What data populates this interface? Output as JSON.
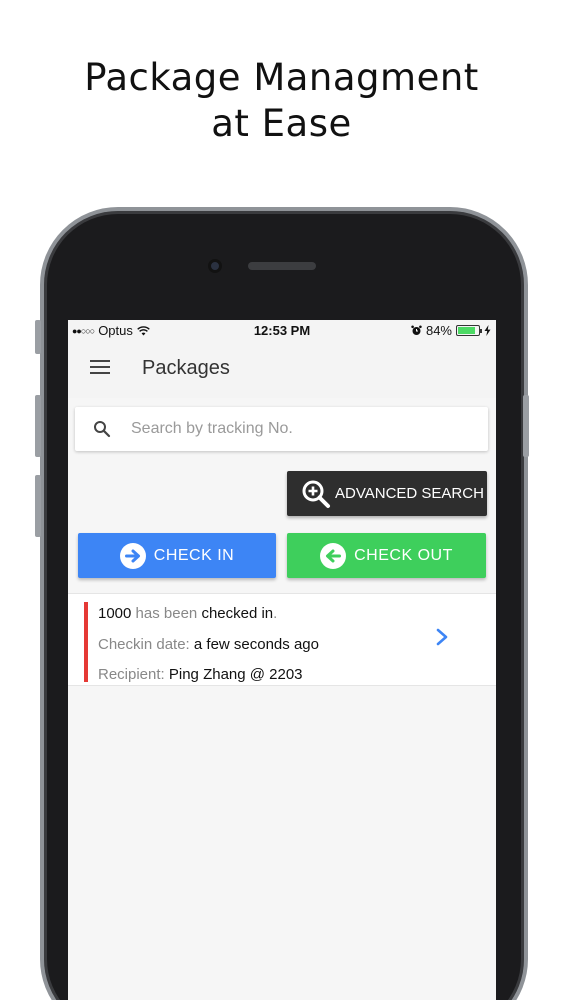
{
  "headline": {
    "line1": "Package Managment",
    "line2": "at Ease"
  },
  "status_bar": {
    "carrier": "Optus",
    "signal_dots": "●●○○○",
    "time": "12:53 PM",
    "battery": "84%",
    "battery_level": 0.84,
    "icons": [
      "wifi-icon",
      "alarm-icon",
      "battery-icon",
      "charging-icon"
    ]
  },
  "app_bar": {
    "title": "Packages",
    "menu_icon": "hamburger-menu-icon"
  },
  "search": {
    "placeholder": "Search by tracking No.",
    "value": "",
    "icon": "search-icon"
  },
  "buttons": {
    "advanced_search": "ADVANCED SEARCH",
    "check_in": "CHECK IN",
    "check_out": "CHECK OUT"
  },
  "notification": {
    "package_id": "1000",
    "has_been": " has been ",
    "action": "checked in",
    "period": ".",
    "checkin_label": "Checkin date: ",
    "checkin_value": "a few seconds ago",
    "recipient_label": "Recipient: ",
    "recipient_value": "Ping Zhang @ 2203"
  },
  "colors": {
    "check_in": "#3d85f5",
    "check_out": "#3ecf5c",
    "advanced_search": "#2e2e2e",
    "notice_accent": "#e53935",
    "chevron": "#3d85f5"
  }
}
